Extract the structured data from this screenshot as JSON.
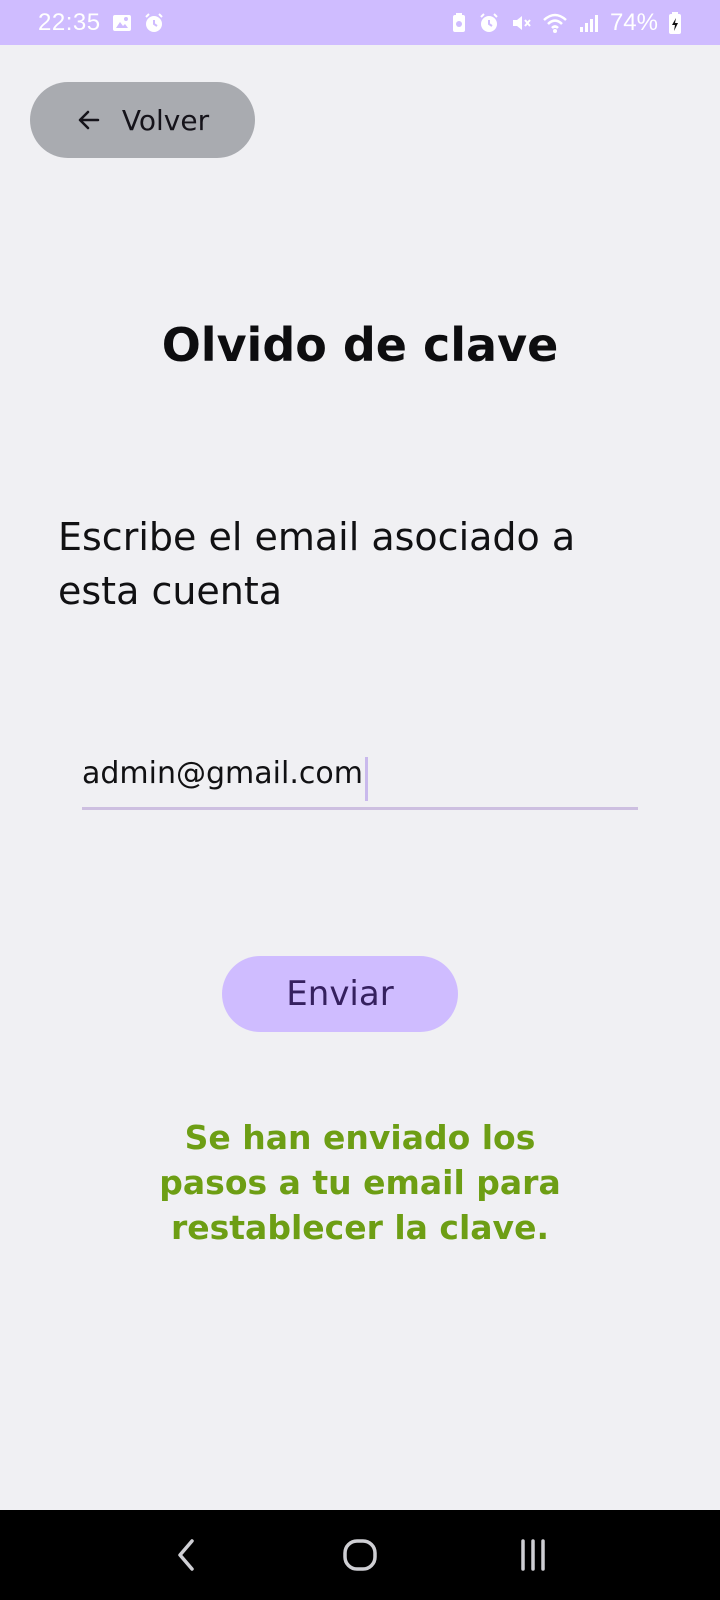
{
  "status_bar": {
    "time": "22:35",
    "battery_percent": "74%",
    "icons_left": [
      "gallery-icon",
      "alarm-icon"
    ],
    "icons_right": [
      "battery-saver-icon",
      "alarm-icon",
      "mute-icon",
      "wifi-icon",
      "signal-icon",
      "battery-icon"
    ]
  },
  "back_button": {
    "label": "Volver",
    "icon": "arrow-left-icon"
  },
  "page_title": "Olvido de clave",
  "instructions": "Escribe el email asociado a esta cuenta",
  "email_input": {
    "value": "admin@gmail.com"
  },
  "send_button": {
    "label": "Enviar"
  },
  "success_message": "Se han enviado los pasos a tu email para restablecer la clave.",
  "nav_bar": {
    "buttons": [
      "back-nav-icon",
      "home-nav-icon",
      "recents-nav-icon"
    ]
  },
  "colors": {
    "status_bar_bg": "#cfbcff",
    "background": "#f0f0f3",
    "back_button_bg": "#a9abb0",
    "send_button_bg": "#cfbcff",
    "send_button_text": "#35205f",
    "success_text": "#6d9e14",
    "input_underline": "#cdbfe0"
  }
}
